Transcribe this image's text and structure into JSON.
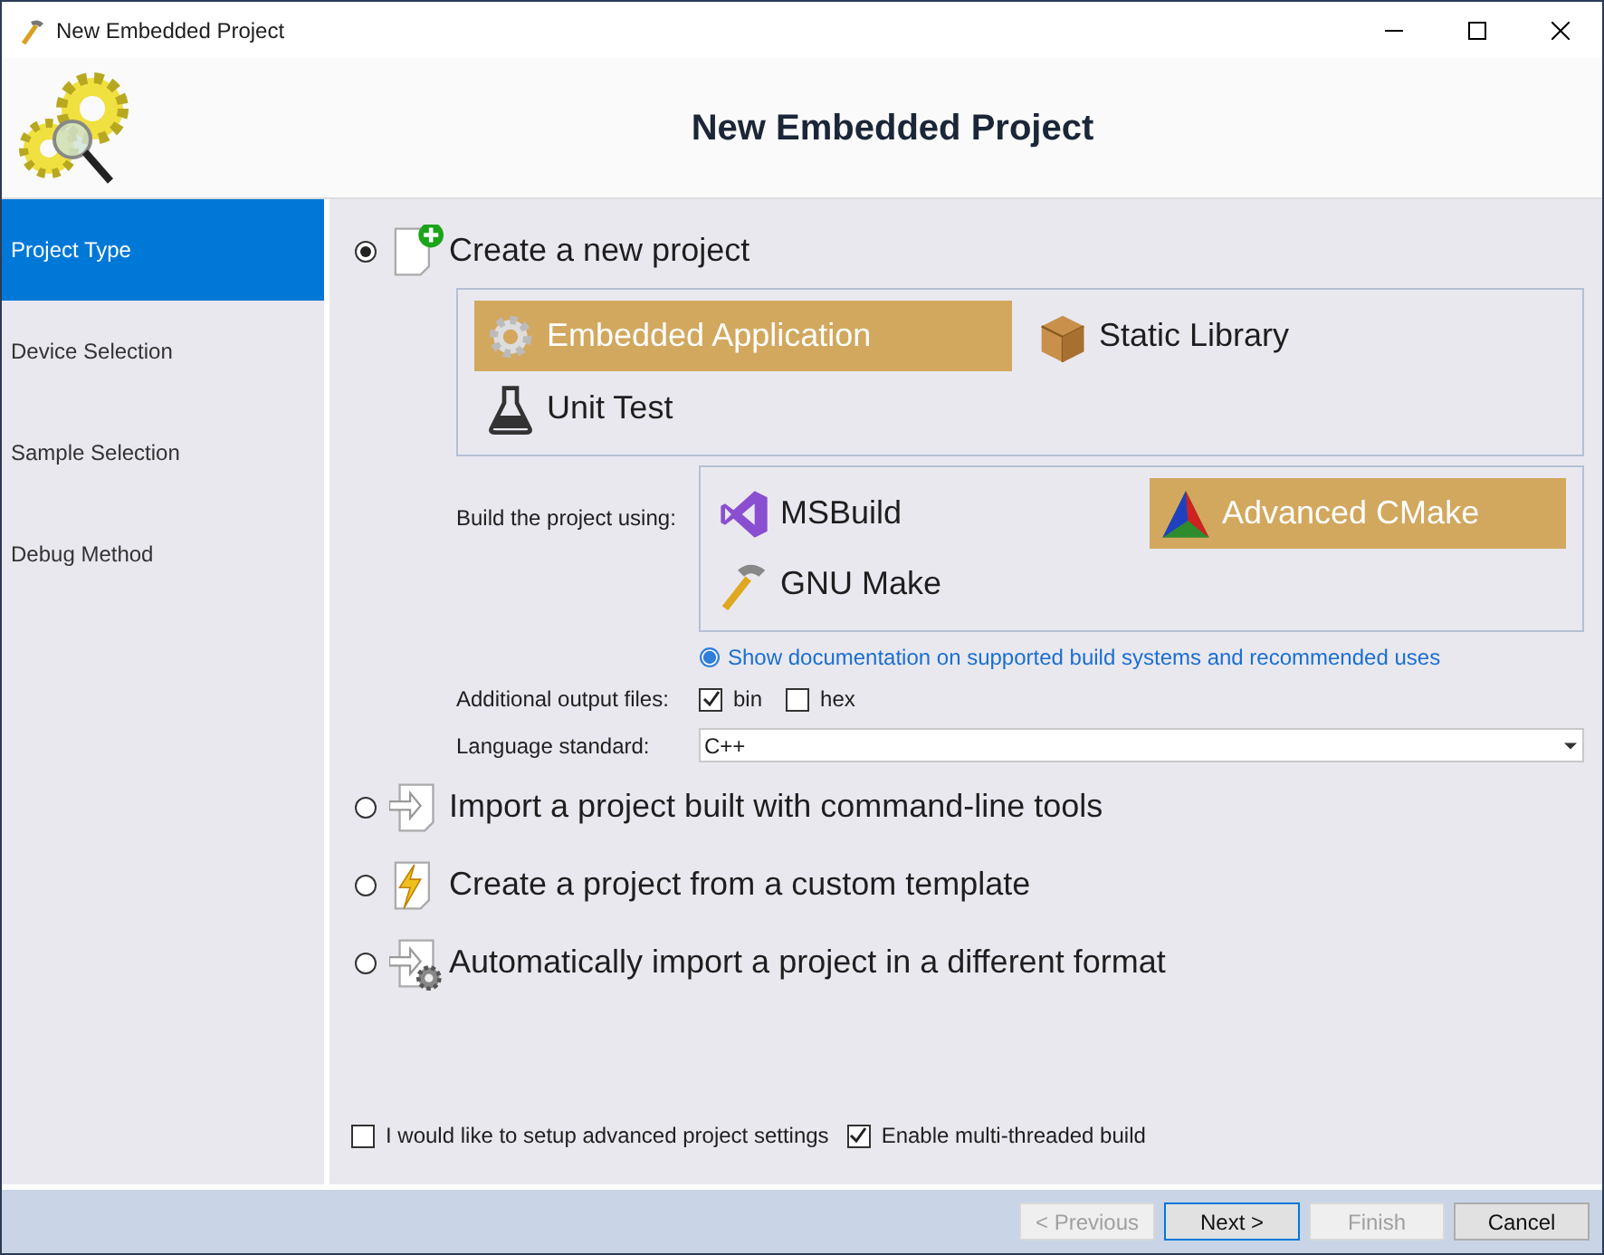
{
  "window": {
    "title": "New Embedded Project"
  },
  "header": {
    "title": "New Embedded Project"
  },
  "sidebar": {
    "items": [
      {
        "label": "Project Type",
        "selected": true
      },
      {
        "label": "Device Selection",
        "selected": false
      },
      {
        "label": "Sample Selection",
        "selected": false
      },
      {
        "label": "Debug Method",
        "selected": false
      }
    ]
  },
  "options": [
    {
      "kind": "new",
      "label": "Create a new project",
      "selected": true
    },
    {
      "kind": "import",
      "label": "Import a project built with command-line tools",
      "selected": false
    },
    {
      "kind": "template",
      "label": "Create a project from a custom template",
      "selected": false
    },
    {
      "kind": "convert",
      "label": "Automatically import a project in a different format",
      "selected": false
    }
  ],
  "project_types": [
    {
      "kind": "gear",
      "label": "Embedded Application",
      "selected": true
    },
    {
      "kind": "box",
      "label": "Static Library",
      "selected": false
    },
    {
      "kind": "flask",
      "label": "Unit Test",
      "selected": false
    }
  ],
  "build": {
    "label": "Build the project using:",
    "systems": [
      {
        "kind": "msbuild",
        "label": "MSBuild",
        "selected": false
      },
      {
        "kind": "cmake",
        "label": "Advanced CMake",
        "selected": true
      },
      {
        "kind": "make",
        "label": "GNU Make",
        "selected": false
      }
    ]
  },
  "doc_link": "Show documentation on supported build systems and recommended uses",
  "output_files": {
    "label": "Additional output files:",
    "items": [
      {
        "label": "bin",
        "checked": true
      },
      {
        "label": "hex",
        "checked": false
      }
    ]
  },
  "language": {
    "label": "Language standard:",
    "value": "C++"
  },
  "settings": [
    {
      "label": "I would like to setup advanced project settings",
      "checked": false
    },
    {
      "label": "Enable multi-threaded build",
      "checked": true
    }
  ],
  "buttons": [
    {
      "label": "< Previous",
      "disabled": true,
      "default": false
    },
    {
      "label": "Next >",
      "disabled": false,
      "default": true
    },
    {
      "label": "Finish",
      "disabled": true,
      "default": false
    },
    {
      "label": "Cancel",
      "disabled": false,
      "default": false
    }
  ]
}
